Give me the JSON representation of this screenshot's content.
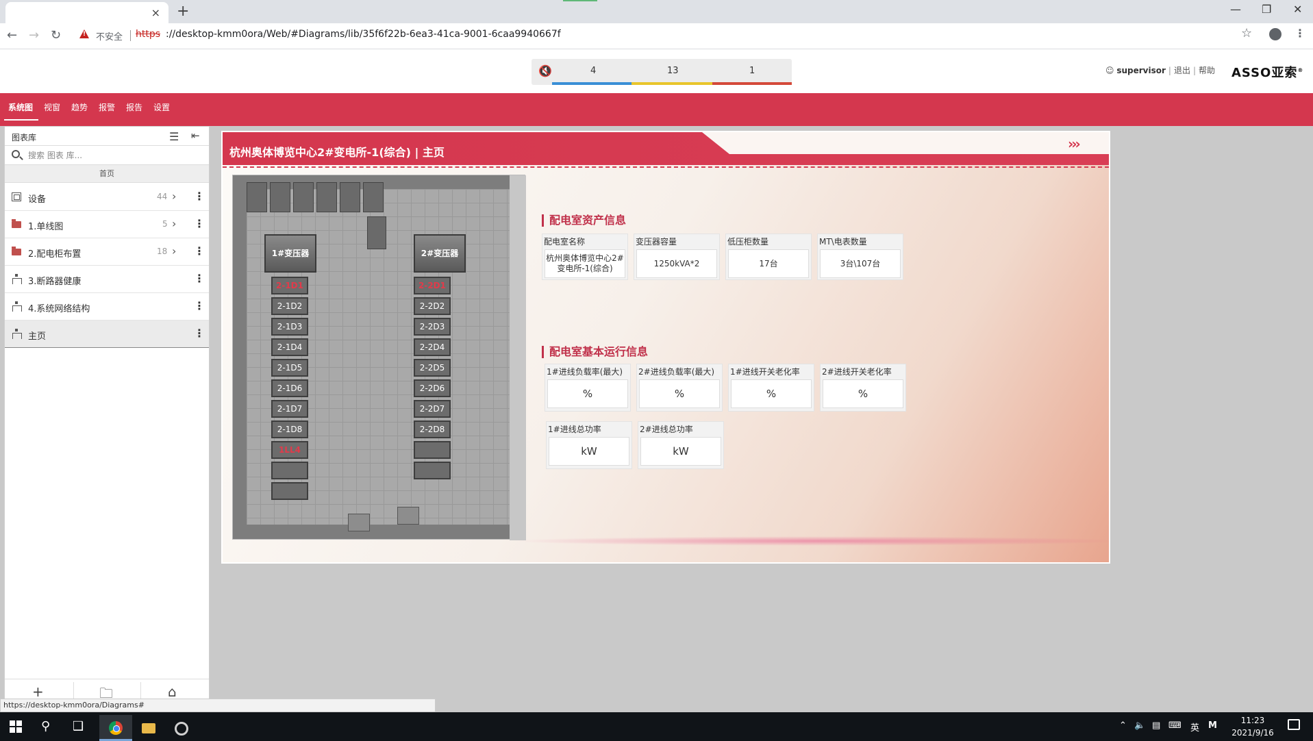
{
  "browser": {
    "url_protocol": "https",
    "url_rest": "://desktop-kmm0ora/Web/#Diagrams/lib/35f6f22b-6ea3-41ca-9001-6caa9940667f",
    "security_label": "不安全",
    "tab_close": "×",
    "new_tab": "+",
    "status_url": "https://desktop-kmm0ora/Diagrams#"
  },
  "header": {
    "alarm_counts": [
      "4",
      "13",
      "1"
    ],
    "alarm_colors": [
      "#3a8fd6",
      "#e8c52b",
      "#d4493a"
    ],
    "user": "supervisor",
    "logout": "退出",
    "help": "帮助",
    "logo": "ASSO亚索",
    "logo_mark": "®"
  },
  "menu": [
    "系统图",
    "视窗",
    "趋势",
    "报警",
    "报告",
    "设置"
  ],
  "sidebar": {
    "title": "图表库",
    "search_placeholder": "搜索 图表 库...",
    "breadcrumb": "首页",
    "items": [
      {
        "label": "设备",
        "count": "44",
        "icon": "device-icon",
        "chevron": true
      },
      {
        "label": "1.单线图",
        "count": "5",
        "icon": "folder-icon",
        "chevron": true
      },
      {
        "label": "2.配电柜布置",
        "count": "18",
        "icon": "folder-icon",
        "chevron": true
      },
      {
        "label": "3.断路器健康",
        "count": "",
        "icon": "tree-icon",
        "chevron": false
      },
      {
        "label": "4.系统网络结构",
        "count": "",
        "icon": "tree-icon",
        "chevron": false
      },
      {
        "label": "主页",
        "count": "",
        "icon": "tree-icon",
        "chevron": false,
        "selected": true
      }
    ]
  },
  "diagram": {
    "title": "杭州奥体博览中心2#变电所-1(综合) | 主页",
    "arrows": "›››",
    "floorplan": {
      "transformer_1": "1#变压器",
      "transformer_2": "2#变压器",
      "left_column": [
        "2-1D1",
        "2-1D2",
        "2-1D3",
        "2-1D4",
        "2-1D5",
        "2-1D6",
        "2-1D7",
        "2-1D8",
        "1LL4",
        "",
        ""
      ],
      "right_column": [
        "2-2D1",
        "2-2D2",
        "2-2D3",
        "2-2D4",
        "2-2D5",
        "2-2D6",
        "2-2D7",
        "2-2D8",
        "",
        ""
      ]
    },
    "asset_section": {
      "title": "配电室资产信息",
      "cells": [
        {
          "caption": "配电室名称",
          "value": "杭州奥体博览中心2#变电所-1(综合)"
        },
        {
          "caption": "变压器容量",
          "value": "1250kVA*2"
        },
        {
          "caption": "低压柜数量",
          "value": "17台"
        },
        {
          "caption": "MT\\电表数量",
          "value": "3台\\107台"
        }
      ]
    },
    "run_section": {
      "title": "配电室基本运行信息",
      "row1": [
        {
          "caption": "1#进线负载率(最大)",
          "value": "%"
        },
        {
          "caption": "2#进线负载率(最大)",
          "value": "%"
        },
        {
          "caption": "1#进线开关老化率",
          "value": "%"
        },
        {
          "caption": "2#进线开关老化率",
          "value": "%"
        }
      ],
      "row2": [
        {
          "caption": "1#进线总功率",
          "value": "kW"
        },
        {
          "caption": "2#进线总功率",
          "value": "kW"
        }
      ]
    }
  },
  "taskbar": {
    "time": "11:23",
    "date": "2021/9/16",
    "ime": "英",
    "ime2": "M"
  }
}
